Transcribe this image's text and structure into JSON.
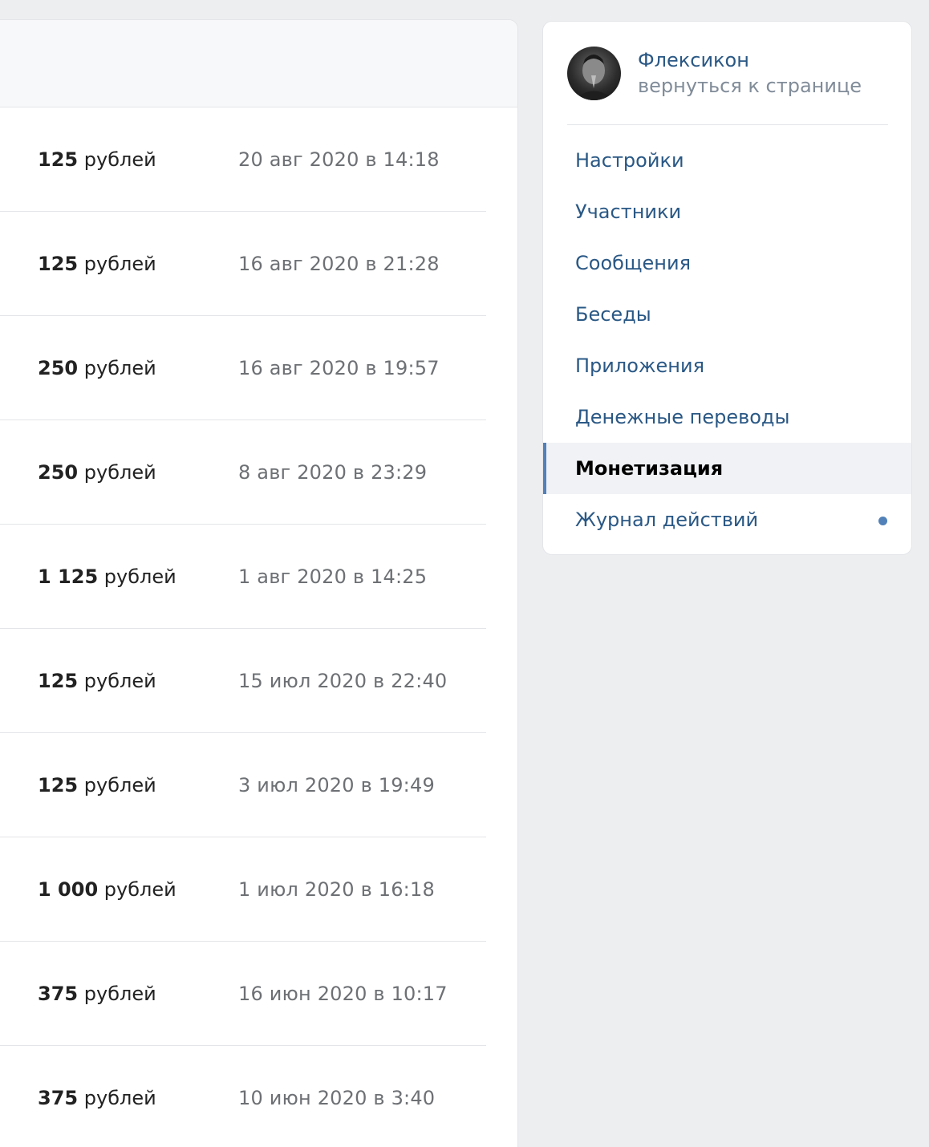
{
  "payouts": [
    {
      "amount": "125",
      "currency": "рублей",
      "date": "20 авг 2020 в 14:18"
    },
    {
      "amount": "125",
      "currency": "рублей",
      "date": "16 авг 2020 в 21:28"
    },
    {
      "amount": "250",
      "currency": "рублей",
      "date": "16 авг 2020 в 19:57"
    },
    {
      "amount": "250",
      "currency": "рублей",
      "date": "8 авг 2020 в 23:29"
    },
    {
      "amount": "1 125",
      "currency": "рублей",
      "date": "1 авг 2020 в 14:25"
    },
    {
      "amount": "125",
      "currency": "рублей",
      "date": "15 июл 2020 в 22:40"
    },
    {
      "amount": "125",
      "currency": "рублей",
      "date": "3 июл 2020 в 19:49"
    },
    {
      "amount": "1 000",
      "currency": "рублей",
      "date": "1 июл 2020 в 16:18"
    },
    {
      "amount": "375",
      "currency": "рублей",
      "date": "16 июн 2020 в 10:17"
    },
    {
      "amount": "375",
      "currency": "рублей",
      "date": "10 июн 2020 в 3:40"
    }
  ],
  "sidebar": {
    "community_name": "Флексикон",
    "back_link": "вернуться к странице",
    "items": [
      {
        "label": "Настройки"
      },
      {
        "label": "Участники"
      },
      {
        "label": "Сообщения"
      },
      {
        "label": "Беседы"
      },
      {
        "label": "Приложения"
      },
      {
        "label": "Денежные переводы"
      },
      {
        "label": "Монетизация",
        "active": true
      },
      {
        "label": "Журнал действий",
        "indicator": "unread-dot"
      }
    ]
  },
  "colors": {
    "link": "#2a5885",
    "active_indicator": "#5181b8",
    "background": "#edeef0"
  }
}
